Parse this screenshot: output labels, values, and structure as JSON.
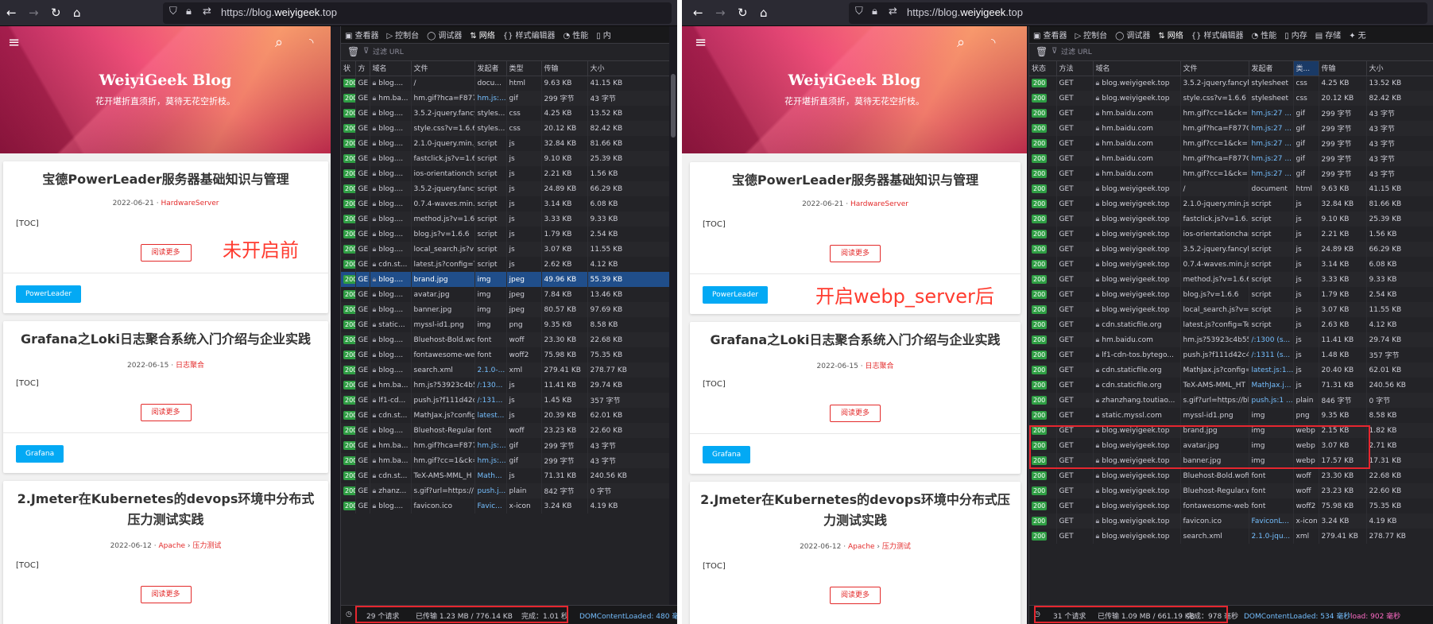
{
  "shared": {
    "url_prefix": "https://blog.",
    "url_domain": "weiyigeek",
    "url_suffix": ".top",
    "blog_title": "WeiyiGeek Blog",
    "blog_subtitle": "花开堪折直须折，莫待无花空折枝。",
    "read_more": "阅读更多",
    "toc": "[TOC]",
    "filter_placeholder": "过滤 URL",
    "posts": [
      {
        "title": "宝德PowerLeader服务器基础知识与管理",
        "date": "2022-06-21",
        "cat1": "HardwareServer",
        "cat2": "",
        "tag": "PowerLeader"
      },
      {
        "title": "Grafana之Loki日志聚合系统入门介绍与企业实践",
        "date": "2022-06-15",
        "cat1": "日志聚合",
        "cat2": "",
        "tag": "Grafana"
      },
      {
        "title": "2.Jmeter在Kubernetes的devops环境中分布式压力测试实践",
        "date": "2022-06-12",
        "cat1": "Apache",
        "cat2": "压力测试",
        "tag": ""
      }
    ]
  },
  "left": {
    "note": "未开启前",
    "tabs": [
      "查看器",
      "控制台",
      "调试器",
      "网络",
      "样式编辑器",
      "性能",
      "内"
    ],
    "tab_icons": [
      "▣",
      "▷",
      "◯",
      "⇅",
      "{}",
      "◔",
      "▯"
    ],
    "active_tab": 3,
    "columns": [
      "状",
      "方",
      "域名",
      "文件",
      "发起者",
      "类型",
      "传输",
      "大小"
    ],
    "rows": [
      [
        "200",
        "GE",
        "blog....",
        "/",
        "docu...",
        "html",
        "9.63 KB",
        "41.15 KB"
      ],
      [
        "200",
        "GE",
        "hm.ba...",
        "hm.gif?hca=F877",
        "hm.js:...",
        "gif",
        "299 字节",
        "43 字节"
      ],
      [
        "200",
        "GE",
        "blog....",
        "3.5.2-jquery.fancy",
        "styles...",
        "css",
        "4.25 KB",
        "13.52 KB"
      ],
      [
        "200",
        "GE",
        "blog....",
        "style.css?v=1.6.6",
        "styles...",
        "css",
        "20.12 KB",
        "82.42 KB"
      ],
      [
        "200",
        "GE",
        "blog....",
        "2.1.0-jquery.min.j",
        "script",
        "js",
        "32.84 KB",
        "81.66 KB"
      ],
      [
        "200",
        "GE",
        "blog....",
        "fastclick.js?v=1.6.",
        "script",
        "js",
        "9.10 KB",
        "25.39 KB"
      ],
      [
        "200",
        "GE",
        "blog....",
        "ios-orientationch",
        "script",
        "js",
        "2.21 KB",
        "1.56 KB"
      ],
      [
        "200",
        "GE",
        "blog....",
        "3.5.2-jquery.fancy",
        "script",
        "js",
        "24.89 KB",
        "66.29 KB"
      ],
      [
        "200",
        "GE",
        "blog....",
        "0.7.4-waves.min.js",
        "script",
        "js",
        "3.14 KB",
        "6.08 KB"
      ],
      [
        "200",
        "GE",
        "blog....",
        "method.js?v=1.6.6",
        "script",
        "js",
        "3.33 KB",
        "9.33 KB"
      ],
      [
        "200",
        "GE",
        "blog....",
        "blog.js?v=1.6.6",
        "script",
        "js",
        "1.79 KB",
        "2.54 KB"
      ],
      [
        "200",
        "GE",
        "blog....",
        "local_search.js?v=",
        "script",
        "js",
        "3.07 KB",
        "11.55 KB"
      ],
      [
        "200",
        "GE",
        "cdn.st...",
        "latest.js?config=T",
        "script",
        "js",
        "2.62 KB",
        "4.12 KB"
      ],
      [
        "200",
        "GE",
        "blog....",
        "brand.jpg",
        "img",
        "jpeg",
        "49.96 KB",
        "55.39 KB"
      ],
      [
        "200",
        "GE",
        "blog....",
        "avatar.jpg",
        "img",
        "jpeg",
        "7.84 KB",
        "13.46 KB"
      ],
      [
        "200",
        "GE",
        "blog....",
        "banner.jpg",
        "img",
        "jpeg",
        "80.57 KB",
        "97.69 KB"
      ],
      [
        "200",
        "GE",
        "static...",
        "myssl-id1.png",
        "img",
        "png",
        "9.35 KB",
        "8.58 KB"
      ],
      [
        "200",
        "GE",
        "blog....",
        "Bluehost-Bold.wo",
        "font",
        "woff",
        "23.30 KB",
        "22.68 KB"
      ],
      [
        "200",
        "GE",
        "blog....",
        "fontawesome-we",
        "font",
        "woff2",
        "75.98 KB",
        "75.35 KB"
      ],
      [
        "200",
        "GE",
        "blog....",
        "search.xml",
        "2.1.0-...",
        "xml",
        "279.41 KB",
        "278.77 KB"
      ],
      [
        "200",
        "GE",
        "hm.ba...",
        "hm.js?53923c4b5",
        "/:130...",
        "js",
        "11.41 KB",
        "29.74 KB"
      ],
      [
        "200",
        "GE",
        "lf1-cd...",
        "push.js?f111d42c",
        "/:131...",
        "js",
        "1.45 KB",
        "357 字节"
      ],
      [
        "200",
        "GE",
        "cdn.st...",
        "MathJax.js?config",
        "latest...",
        "js",
        "20.39 KB",
        "62.01 KB"
      ],
      [
        "200",
        "GE",
        "blog....",
        "Bluehost-Regular.",
        "font",
        "woff",
        "23.23 KB",
        "22.60 KB"
      ],
      [
        "200",
        "GE",
        "hm.ba...",
        "hm.gif?hca=F877",
        "hm.js:...",
        "gif",
        "299 字节",
        "43 字节"
      ],
      [
        "200",
        "GE",
        "hm.ba...",
        "hm.gif?cc=1&ck=",
        "hm.js:...",
        "gif",
        "299 字节",
        "43 字节"
      ],
      [
        "200",
        "GE",
        "cdn.st...",
        "TeX-AMS-MML_H",
        "Math...",
        "js",
        "71.31 KB",
        "240.56 KB"
      ],
      [
        "200",
        "GE",
        "zhanz...",
        "s.gif?url=https://",
        "push.j...",
        "plain",
        "842 字节",
        "0 字节"
      ],
      [
        "200",
        "GE",
        "blog....",
        "favicon.ico",
        "Favic...",
        "x-icon",
        "3.24 KB",
        "4.19 KB"
      ]
    ],
    "selected_row": 13,
    "status_requests": "29 个请求",
    "status_transfer": "已传输 1.23 MB / 776.14 KB",
    "status_finish": "完成：1.01 秒",
    "status_dom": "DOMContentLoaded: 480 毫",
    "status_load": ""
  },
  "right": {
    "note": "开启webp_server后",
    "tabs": [
      "查看器",
      "控制台",
      "调试器",
      "网络",
      "样式编辑器",
      "性能",
      "内存",
      "存储",
      "无"
    ],
    "tab_icons": [
      "▣",
      "▷",
      "◯",
      "⇅",
      "{}",
      "◔",
      "▯",
      "▤",
      "✦"
    ],
    "active_tab": 3,
    "columns": [
      "状态",
      "方法",
      "域名",
      "文件",
      "发起者",
      "类...",
      "传输",
      "大小"
    ],
    "sorted_column": 5,
    "rows": [
      [
        "200",
        "GET",
        "blog.weiyigeek.top",
        "3.5.2-jquery.fancyb",
        "stylesheet",
        "css",
        "4.25 KB",
        "13.52 KB"
      ],
      [
        "200",
        "GET",
        "blog.weiyigeek.top",
        "style.css?v=1.6.6",
        "stylesheet",
        "css",
        "20.12 KB",
        "82.42 KB"
      ],
      [
        "200",
        "GET",
        "hm.baidu.com",
        "hm.gif?cc=1&ck=1",
        "hm.js:27 ...",
        "gif",
        "299 字节",
        "43 字节"
      ],
      [
        "200",
        "GET",
        "hm.baidu.com",
        "hm.gif?hca=F877C",
        "hm.js:27 ...",
        "gif",
        "299 字节",
        "43 字节"
      ],
      [
        "200",
        "GET",
        "hm.baidu.com",
        "hm.gif?cc=1&ck=1",
        "hm.js:27 ...",
        "gif",
        "299 字节",
        "43 字节"
      ],
      [
        "200",
        "GET",
        "hm.baidu.com",
        "hm.gif?hca=F877C",
        "hm.js:27 ...",
        "gif",
        "299 字节",
        "43 字节"
      ],
      [
        "200",
        "GET",
        "hm.baidu.com",
        "hm.gif?cc=1&ck=1",
        "hm.js:27 ...",
        "gif",
        "299 字节",
        "43 字节"
      ],
      [
        "200",
        "GET",
        "blog.weiyigeek.top",
        "/",
        "document",
        "html",
        "9.63 KB",
        "41.15 KB"
      ],
      [
        "200",
        "GET",
        "blog.weiyigeek.top",
        "2.1.0-jquery.min.js",
        "script",
        "js",
        "32.84 KB",
        "81.66 KB"
      ],
      [
        "200",
        "GET",
        "blog.weiyigeek.top",
        "fastclick.js?v=1.6.6",
        "script",
        "js",
        "9.10 KB",
        "25.39 KB"
      ],
      [
        "200",
        "GET",
        "blog.weiyigeek.top",
        "ios-orientationchar",
        "script",
        "js",
        "2.21 KB",
        "1.56 KB"
      ],
      [
        "200",
        "GET",
        "blog.weiyigeek.top",
        "3.5.2-jquery.fancyb",
        "script",
        "js",
        "24.89 KB",
        "66.29 KB"
      ],
      [
        "200",
        "GET",
        "blog.weiyigeek.top",
        "0.7.4-waves.min.js",
        "script",
        "js",
        "3.14 KB",
        "6.08 KB"
      ],
      [
        "200",
        "GET",
        "blog.weiyigeek.top",
        "method.js?v=1.6.6",
        "script",
        "js",
        "3.33 KB",
        "9.33 KB"
      ],
      [
        "200",
        "GET",
        "blog.weiyigeek.top",
        "blog.js?v=1.6.6",
        "script",
        "js",
        "1.79 KB",
        "2.54 KB"
      ],
      [
        "200",
        "GET",
        "blog.weiyigeek.top",
        "local_search.js?v=1",
        "script",
        "js",
        "3.07 KB",
        "11.55 KB"
      ],
      [
        "200",
        "GET",
        "cdn.staticfile.org",
        "latest.js?config=Te)",
        "script",
        "js",
        "2.63 KB",
        "4.12 KB"
      ],
      [
        "200",
        "GET",
        "hm.baidu.com",
        "hm.js?53923c4b55(",
        "/:1300 (s...",
        "js",
        "11.41 KB",
        "29.74 KB"
      ],
      [
        "200",
        "GET",
        "lf1-cdn-tos.bytego...",
        "push.js?f111d42c4(",
        "/:1311 (s...",
        "js",
        "1.48 KB",
        "357 字节"
      ],
      [
        "200",
        "GET",
        "cdn.staticfile.org",
        "MathJax.js?config=",
        "latest.js:1...",
        "js",
        "20.40 KB",
        "62.01 KB"
      ],
      [
        "200",
        "GET",
        "cdn.staticfile.org",
        "TeX-AMS-MML_HT",
        "MathJax.j...",
        "js",
        "71.31 KB",
        "240.56 KB"
      ],
      [
        "200",
        "GET",
        "zhanzhang.toutiao...",
        "s.gif?url=https://bl",
        "push.js:1 ...",
        "plain",
        "846 字节",
        "0 字节"
      ],
      [
        "200",
        "GET",
        "static.myssl.com",
        "myssl-id1.png",
        "img",
        "png",
        "9.35 KB",
        "8.58 KB"
      ],
      [
        "200",
        "GET",
        "blog.weiyigeek.top",
        "brand.jpg",
        "img",
        "webp",
        "2.15 KB",
        "1.82 KB"
      ],
      [
        "200",
        "GET",
        "blog.weiyigeek.top",
        "avatar.jpg",
        "img",
        "webp",
        "3.07 KB",
        "2.71 KB"
      ],
      [
        "200",
        "GET",
        "blog.weiyigeek.top",
        "banner.jpg",
        "img",
        "webp",
        "17.57 KB",
        "17.31 KB"
      ],
      [
        "200",
        "GET",
        "blog.weiyigeek.top",
        "Bluehost-Bold.woff",
        "font",
        "woff",
        "23.30 KB",
        "22.68 KB"
      ],
      [
        "200",
        "GET",
        "blog.weiyigeek.top",
        "Bluehost-Regular.w",
        "font",
        "woff",
        "23.23 KB",
        "22.60 KB"
      ],
      [
        "200",
        "GET",
        "blog.weiyigeek.top",
        "fontawesome-webf",
        "font",
        "woff2",
        "75.98 KB",
        "75.35 KB"
      ],
      [
        "200",
        "GET",
        "blog.weiyigeek.top",
        "favicon.ico",
        "FaviconL...",
        "x-icon",
        "3.24 KB",
        "4.19 KB"
      ],
      [
        "200",
        "GET",
        "blog.weiyigeek.top",
        "search.xml",
        "2.1.0-jqu...",
        "xml",
        "279.41 KB",
        "278.77 KB"
      ]
    ],
    "selected_row": -1,
    "status_requests": "31 个请求",
    "status_transfer": "已传输 1.09 MB / 661.19 KB",
    "status_finish": "完成：978 毫秒",
    "status_dom": "DOMContentLoaded: 534 毫秒",
    "status_load": "load: 902 毫秒"
  }
}
